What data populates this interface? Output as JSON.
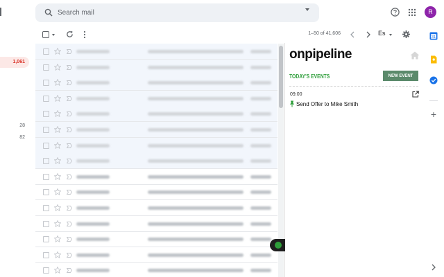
{
  "search": {
    "placeholder": "Search mail"
  },
  "user": {
    "avatar_letter": "R",
    "avatar_color": "#8e24aa"
  },
  "nav": {
    "inbox_count": "1,061",
    "count_a": "28",
    "count_b": "82"
  },
  "toolbar": {
    "pagination": "1–50 of 41,606",
    "language": "Es"
  },
  "mail": {
    "rows": 15,
    "read_background": "#f2f6fc"
  },
  "panel": {
    "logo": "onpipeline",
    "section_title": "TODAY'S EVENTS",
    "new_event_label": "NEW EVENT",
    "accent_color": "#2e9e3a",
    "button_color": "#5b8a6b",
    "events": [
      {
        "time": "09:00",
        "title": "Send Offer to Mike Smith"
      }
    ]
  }
}
